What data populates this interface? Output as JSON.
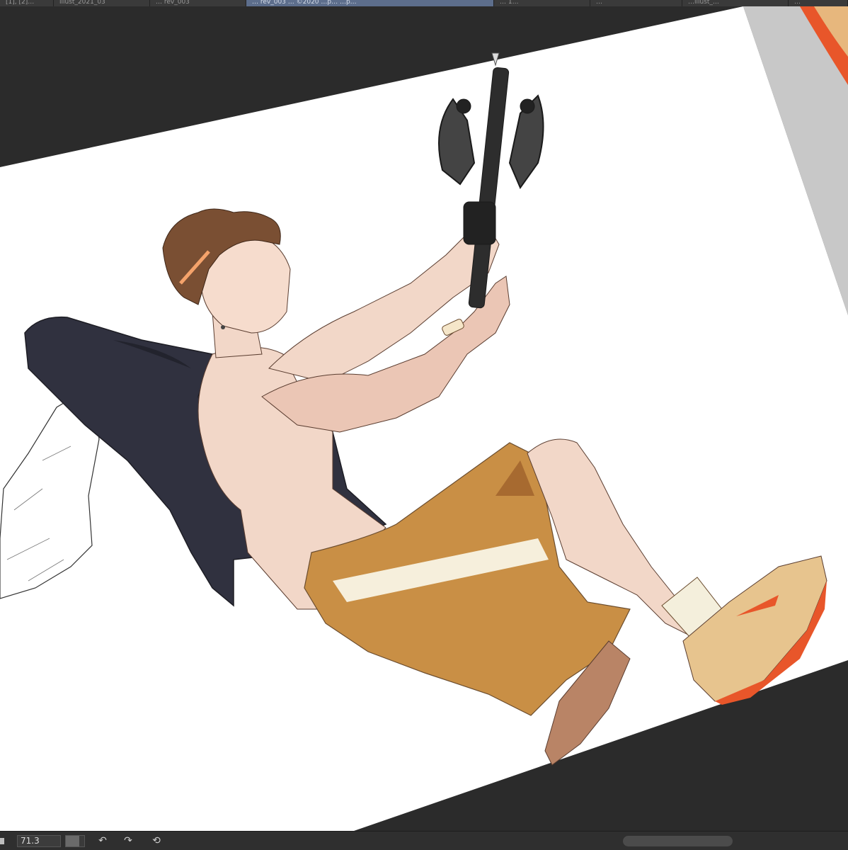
{
  "tabs": [
    {
      "label": "[1], [2]…"
    },
    {
      "label": "illust_2021_03"
    },
    {
      "label": "… rev_003"
    },
    {
      "label": "… rev_003 … ©2020 …p… …p…"
    },
    {
      "label": "… 1…"
    },
    {
      "label": "…"
    },
    {
      "label": "…illust_…"
    },
    {
      "label": "…"
    }
  ],
  "status": {
    "zoom_value": "71.3",
    "zoom_fraction": 0.713,
    "undo_icon": "undo-icon",
    "redo_icon": "redo-icon",
    "reset_icon": "rotate-reset-icon"
  },
  "colors": {
    "workspace": "#2b2b2b",
    "paper": "#ffffff",
    "offcanvas": "#c8c8c8",
    "jacket": "#30313f",
    "shorts": "#c98f45",
    "skin": "#f2d7c8",
    "hair": "#7a4f33",
    "shoe_orange": "#e8562a"
  }
}
